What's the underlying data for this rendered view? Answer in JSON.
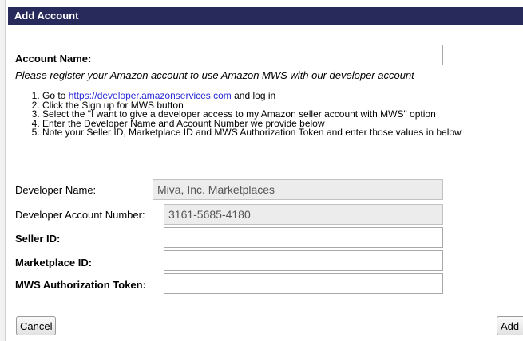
{
  "title": "Add Account",
  "account_name": {
    "label": "Account Name:",
    "value": ""
  },
  "note": "Please register your Amazon account to use Amazon MWS with our developer account",
  "steps": {
    "s1_prefix": "Go to ",
    "s1_link": "https://developer.amazonservices.com",
    "s1_suffix": " and log in",
    "s2": "Click the Sign up for MWS button",
    "s3": "Select the \"I want to give a developer access to my Amazon seller account with MWS\" option",
    "s4": "Enter the Developer Name and Account Number we provide below",
    "s5": "Note your Seller ID, Marketplace ID and MWS Authorization Token and enter those values in below"
  },
  "developer_name": {
    "label": "Developer Name:",
    "value": "Miva, Inc. Marketplaces"
  },
  "developer_account_number": {
    "label": "Developer Account Number:",
    "value": "3161-5685-4180"
  },
  "seller_id": {
    "label": "Seller ID:",
    "value": ""
  },
  "marketplace_id": {
    "label": "Marketplace ID:",
    "value": ""
  },
  "mws_token": {
    "label": "MWS Authorization Token:",
    "value": ""
  },
  "buttons": {
    "cancel": "Cancel",
    "add": "Add"
  }
}
